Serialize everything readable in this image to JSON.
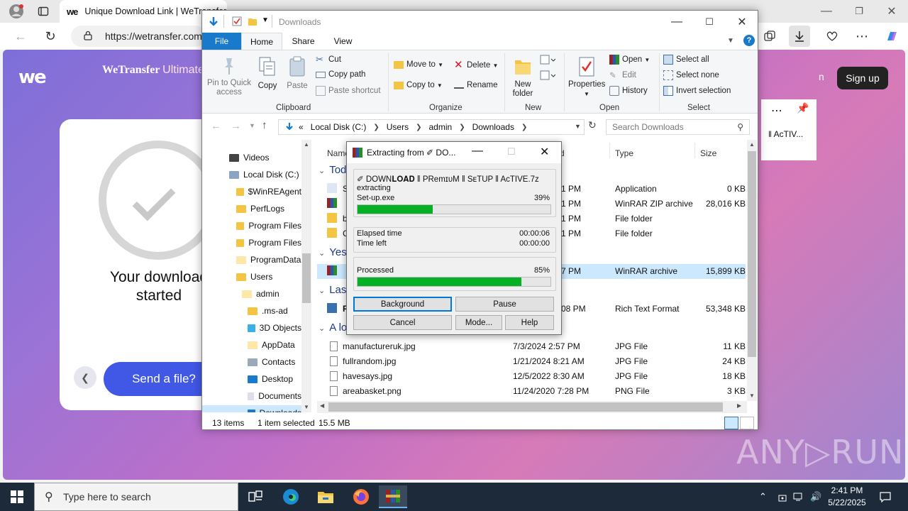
{
  "browser": {
    "tab_title": "Unique Download Link | WeTransfer",
    "tab_favicon": "we",
    "url": "https://wetransfer.com",
    "page": {
      "brand_name": "WeTransfer",
      "brand_suffix": "Ultimate",
      "download_line1": "Your download",
      "download_line2": "started",
      "send_button": "Send a file?",
      "signup_button": "Sign up",
      "partial_text": "n",
      "partial_tab": "‖ AcTIV...",
      "watermark": "ANY▷RUN"
    }
  },
  "explorer": {
    "title": "Downloads",
    "tabs": [
      "File",
      "Home",
      "Share",
      "View"
    ],
    "clipboard": {
      "pin": "Pin to Quick access",
      "copy": "Copy",
      "paste": "Paste",
      "cut": "Cut",
      "copy_path": "Copy path",
      "paste_shortcut": "Paste shortcut",
      "label": "Clipboard"
    },
    "organize": {
      "move_to": "Move to",
      "copy_to": "Copy to",
      "delete": "Delete",
      "rename": "Rename",
      "label": "Organize"
    },
    "new": {
      "new_folder_1": "New",
      "new_folder_2": "folder",
      "label": "New"
    },
    "open": {
      "properties": "Properties",
      "open": "Open",
      "edit": "Edit",
      "history": "History",
      "label": "Open"
    },
    "select": {
      "select_all": "Select all",
      "select_none": "Select none",
      "invert": "Invert selection",
      "label": "Select"
    },
    "address": {
      "prefix": "«",
      "crumbs": [
        "Local Disk (C:)",
        "Users",
        "admin",
        "Downloads"
      ]
    },
    "search_placeholder": "Search Downloads",
    "nav": [
      "Videos",
      "Local Disk (C:)",
      "$WinREAgent",
      "PerfLogs",
      "Program Files",
      "Program Files",
      "ProgramData",
      "Users",
      "admin",
      ".ms-ad",
      "3D Objects",
      "AppData",
      "Contacts",
      "Desktop",
      "Documents",
      "Downloads"
    ],
    "columns": {
      "name": "Name",
      "date": "d",
      "type": "Type",
      "size": "Size"
    },
    "groups": [
      "Tod",
      "Yes",
      "Las",
      "A lo"
    ],
    "files_partial": [
      {
        "name": "S",
        "date": "1 PM",
        "type": "Application",
        "size": "0 KB"
      },
      {
        "name": "",
        "date": "1 PM",
        "type": "WinRAR ZIP archive",
        "size": "28,016 KB"
      },
      {
        "name": "b",
        "date": "1 PM",
        "type": "File folder",
        "size": ""
      },
      {
        "name": "C",
        "date": "1 PM",
        "type": "File folder",
        "size": ""
      },
      {
        "name": "",
        "date": "7 PM",
        "type": "WinRAR archive",
        "size": "15,899 KB"
      },
      {
        "name": "R",
        "date": "08 PM",
        "type": "Rich Text Format",
        "size": "53,348 KB"
      }
    ],
    "files": [
      {
        "name": "manufactureruk.jpg",
        "date": "7/3/2024 2:57 PM",
        "type": "JPG File",
        "size": "11 KB"
      },
      {
        "name": "fullrandom.jpg",
        "date": "1/21/2024 8:21 AM",
        "type": "JPG File",
        "size": "24 KB"
      },
      {
        "name": "havesays.jpg",
        "date": "12/5/2022 8:30 AM",
        "type": "JPG File",
        "size": "18 KB"
      },
      {
        "name": "areabasket.png",
        "date": "11/24/2020 7:28 PM",
        "type": "PNG File",
        "size": "3 KB"
      }
    ],
    "status": {
      "items": "13 items",
      "selected": "1 item selected",
      "size": "15.5 MB"
    }
  },
  "rar": {
    "title": "Extracting from ✐ DO...",
    "archive": "✐ DOWN𝐋𝐎𝐀𝐃 ‖ PRemɪᴜM ‖ SᴇTUP ‖ AcTIVE.7z",
    "action": "extracting",
    "file": "Set-up.exe",
    "file_pct_text": "39%",
    "file_progress": 0.39,
    "elapsed_label": "Elapsed time",
    "elapsed": "00:00:06",
    "left_label": "Time left",
    "left": "00:00:00",
    "processed_label": "Processed",
    "processed_pct_text": "85%",
    "processed_progress": 0.85,
    "buttons": {
      "background": "Background",
      "pause": "Pause",
      "cancel": "Cancel",
      "mode": "Mode...",
      "help": "Help"
    }
  },
  "taskbar": {
    "search_placeholder": "Type here to search",
    "time": "2:41 PM",
    "date": "5/22/2025"
  },
  "colors": {
    "accent_blue": "#1979ca",
    "progress_green": "#06b025",
    "we_blue": "#4157e6",
    "taskbar": "#1c2a3a"
  }
}
